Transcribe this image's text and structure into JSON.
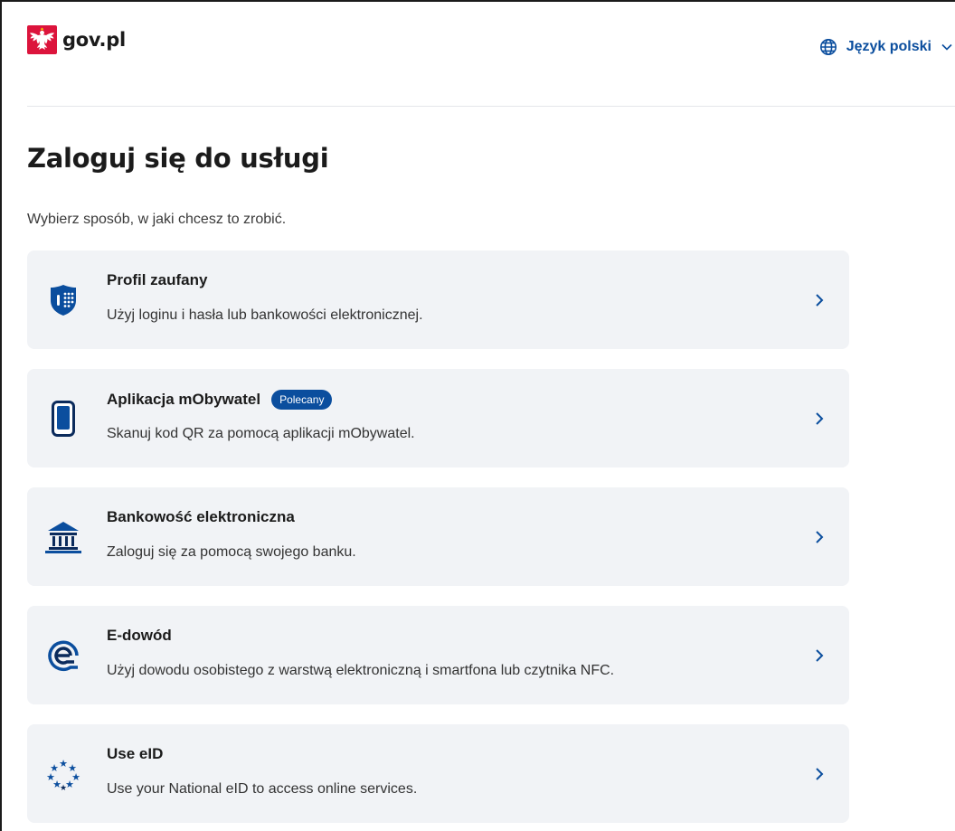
{
  "header": {
    "logo_text": "gov.pl",
    "language_label": "Język polski",
    "colors": {
      "accent": "#0b4e9e",
      "emblem_red": "#dc143c"
    }
  },
  "page": {
    "title": "Zaloguj się do usługi",
    "subtitle": "Wybierz sposób, w jaki chcesz to zrobić."
  },
  "options": [
    {
      "title": "Profil zaufany",
      "description": "Użyj loginu i hasła lub bankowości elektronicznej.",
      "icon": "shield-icon"
    },
    {
      "title": "Aplikacja mObywatel",
      "badge": "Polecany",
      "description": "Skanuj kod QR za pomocą aplikacji mObywatel.",
      "icon": "smartphone-icon"
    },
    {
      "title": "Bankowość elektroniczna",
      "description": "Zaloguj się za pomocą swojego banku.",
      "icon": "bank-icon"
    },
    {
      "title": "E-dowód",
      "description": "Użyj dowodu osobistego z warstwą elektroniczną i smartfona lub czytnika NFC.",
      "icon": "e-id-icon"
    },
    {
      "title": "Use eID",
      "description": "Use your National eID to access online services.",
      "icon": "eu-stars-icon"
    }
  ]
}
